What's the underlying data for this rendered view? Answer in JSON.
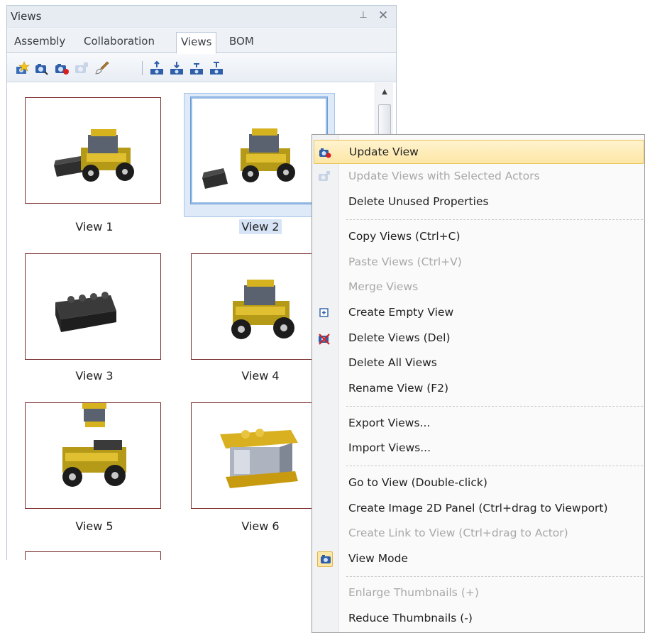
{
  "panel": {
    "title": "Views",
    "pin_glyph": "⊥",
    "close_glyph": "✕",
    "tabs": [
      {
        "label": "Assembly"
      },
      {
        "label": "Collaboration"
      },
      {
        "label": "Views"
      },
      {
        "label": "BOM"
      }
    ],
    "active_tab": "Views",
    "toolbar_icons": [
      "create-view-icon",
      "update-view-icon",
      "update-view-red-icon",
      "update-views-selected-icon",
      "brush-icon",
      "align-top-icon",
      "align-center-icon",
      "align-bottom-icon",
      "align-left-icon"
    ],
    "views": [
      {
        "label": "View 1"
      },
      {
        "label": "View 2"
      },
      {
        "label": "View 3"
      },
      {
        "label": "View 4"
      },
      {
        "label": "View 5"
      },
      {
        "label": "View 6"
      }
    ],
    "selected_view": "View 2"
  },
  "context_menu": {
    "items": [
      {
        "label": "Update View",
        "icon": "camera-update-icon",
        "disabled": false
      },
      {
        "label": "Update Views with Selected Actors",
        "icon": "camera-actors-icon",
        "disabled": true
      },
      {
        "label": "Delete Unused Properties",
        "disabled": false
      },
      {
        "label": "Copy Views (Ctrl+C)",
        "disabled": false
      },
      {
        "label": "Paste Views (Ctrl+V)",
        "disabled": true
      },
      {
        "label": "Merge Views",
        "disabled": true
      },
      {
        "label": "Create Empty View",
        "icon": "add-view-icon",
        "disabled": false
      },
      {
        "label": "Delete Views (Del)",
        "icon": "delete-view-icon",
        "disabled": false
      },
      {
        "label": "Delete All Views",
        "disabled": false
      },
      {
        "label": "Rename View (F2)",
        "disabled": false
      },
      {
        "label": "Export Views...",
        "disabled": false
      },
      {
        "label": "Import Views...",
        "disabled": false
      },
      {
        "label": "Go to View (Double-click)",
        "disabled": false
      },
      {
        "label": "Create Image 2D Panel (Ctrl+drag to Viewport)",
        "disabled": false
      },
      {
        "label": "Create Link to View (Ctrl+drag to Actor)",
        "disabled": true
      },
      {
        "label": "View Mode",
        "icon": "view-mode-icon",
        "checked": true,
        "disabled": false
      },
      {
        "label": "Enlarge Thumbnails (+)",
        "disabled": true
      },
      {
        "label": "Reduce Thumbnails (-)",
        "disabled": false
      }
    ]
  },
  "colors": {
    "highlight": "#fde7a6",
    "thumb_border": "#7a2e2e",
    "selection": "#9cbfe7",
    "disabled_text": "#a8a8a8"
  }
}
